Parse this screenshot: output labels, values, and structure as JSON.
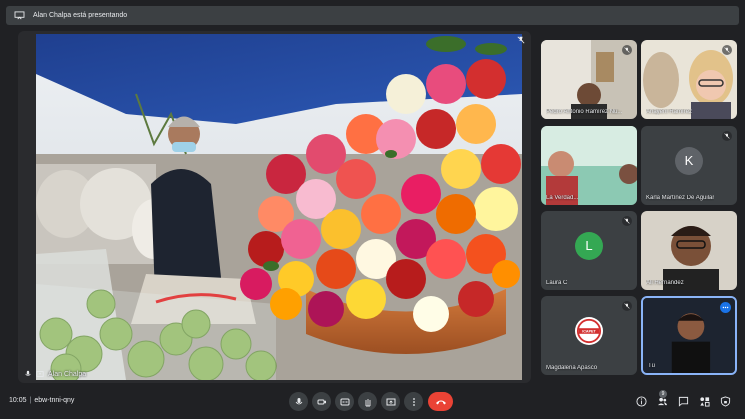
{
  "header": {
    "presenting_text": "Alan Chalpa está presentando"
  },
  "stage": {
    "presenter_label": "Alan Chalpa"
  },
  "participants": [
    {
      "name": "Pedro Antonio Ramírez Nú...",
      "muted": true
    },
    {
      "name": "Anayeni Ramírez",
      "muted": true
    },
    {
      "name": "La Verdad... ",
      "muted": false
    },
    {
      "name": "Karla Martínez De Aguilar",
      "initial": "K",
      "avatar_color": "#5f6368",
      "muted": true
    },
    {
      "name": "Laura C",
      "initial": "L",
      "avatar_color": "#34a853",
      "muted": true
    },
    {
      "name": "Ali Hernandez",
      "muted": false
    },
    {
      "name": "Magdalena Apasco",
      "logo_text": "ICAPET",
      "muted": true
    },
    {
      "name": "Tú",
      "muted": false
    }
  ],
  "bottom": {
    "time": "10:05",
    "separator": "|",
    "meeting_code": "ebw-tnni-qny",
    "people_count": "9"
  },
  "colors": {
    "accent": "#8ab4f8",
    "end_call": "#ea4335",
    "surface": "#3c4043"
  }
}
